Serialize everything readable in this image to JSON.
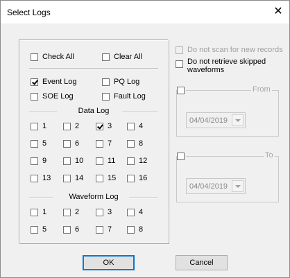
{
  "window": {
    "title": "Select Logs",
    "close_glyph": "✕"
  },
  "top_options": {
    "check_all": "Check All",
    "clear_all": "Clear All"
  },
  "log_types": {
    "event_log": "Event Log",
    "pq_log": "PQ Log",
    "soe_log": "SOE Log",
    "fault_log": "Fault Log",
    "event_log_checked": true
  },
  "data_log": {
    "title": "Data Log",
    "items": [
      "1",
      "2",
      "3",
      "4",
      "5",
      "6",
      "7",
      "8",
      "9",
      "10",
      "11",
      "12",
      "13",
      "14",
      "15",
      "16"
    ],
    "checked": [
      "3"
    ]
  },
  "waveform_log": {
    "title": "Waveform Log",
    "items": [
      "1",
      "2",
      "3",
      "4",
      "5",
      "6",
      "7",
      "8"
    ]
  },
  "right_options": {
    "no_scan": "Do not scan for new records",
    "no_retrieve_line1": "Do not retrieve skipped",
    "no_retrieve_line2": "waveforms"
  },
  "from": {
    "label": "From",
    "date": "04/04/2019"
  },
  "to": {
    "label": "To",
    "date": "04/04/2019"
  },
  "buttons": {
    "ok": "OK",
    "cancel": "Cancel"
  }
}
